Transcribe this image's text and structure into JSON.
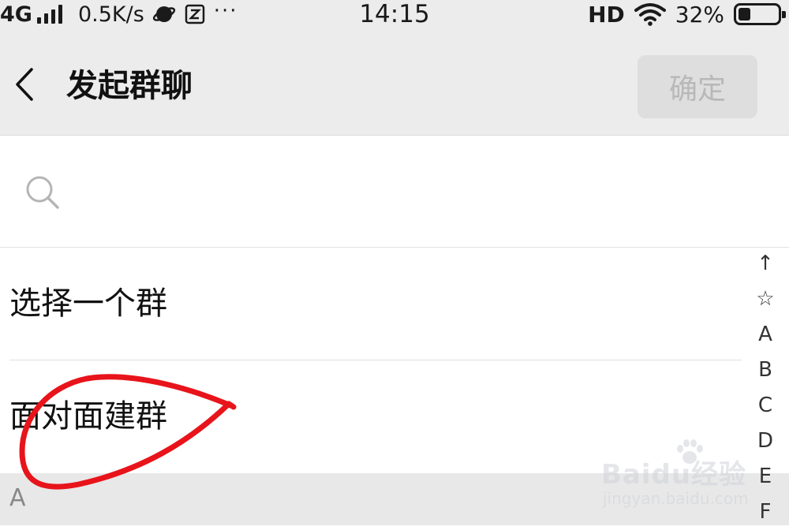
{
  "status_bar": {
    "network": "4G",
    "speed": "0.5K/s",
    "more": "···",
    "time": "14:15",
    "hd": "HD",
    "battery_percent": "32%",
    "battery_level": 0.32
  },
  "header": {
    "title": "发起群聊",
    "confirm_label": "确定"
  },
  "search": {
    "placeholder": "",
    "value": ""
  },
  "list": {
    "items": [
      {
        "label": "选择一个群"
      },
      {
        "label": "面对面建群"
      }
    ],
    "section_header": "A"
  },
  "alpha_index": [
    "↑",
    "☆",
    "A",
    "B",
    "C",
    "D",
    "E",
    "F"
  ],
  "watermark": {
    "brand": "Baidu经验",
    "url": "jingyan.baidu.com"
  },
  "colors": {
    "header_bg": "#ececec",
    "confirm_disabled_bg": "#dedede",
    "confirm_disabled_text": "#b8b8b8",
    "annotation_stroke": "#e8141b"
  }
}
